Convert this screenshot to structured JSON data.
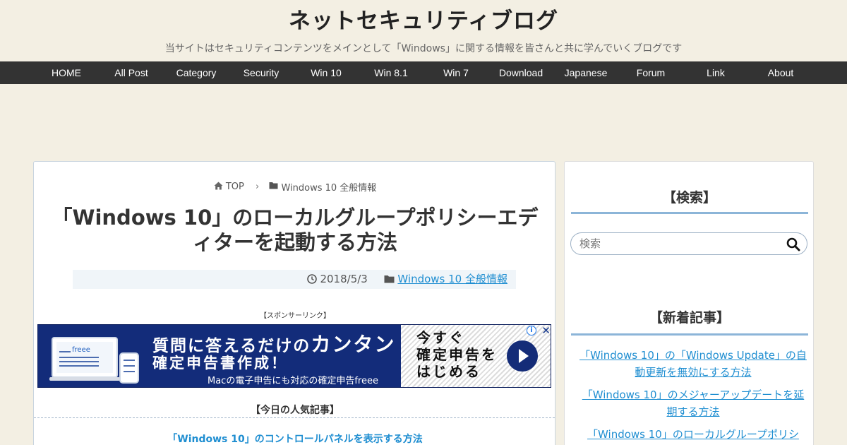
{
  "site": {
    "title": "ネットセキュリティブログ",
    "description": "当サイトはセキュリティコンテンツをメインとして「Windows」に関する情報を皆さんと共に学んでいくブログです"
  },
  "nav": {
    "items": [
      {
        "label": "HOME"
      },
      {
        "label": "All Post"
      },
      {
        "label": "Category"
      },
      {
        "label": "Security"
      },
      {
        "label": "Win 10"
      },
      {
        "label": "Win 8.1"
      },
      {
        "label": "Win 7"
      },
      {
        "label": "Download"
      },
      {
        "label": "Japanese"
      },
      {
        "label": "Forum"
      },
      {
        "label": "Link"
      },
      {
        "label": "About"
      }
    ]
  },
  "breadcrumb": {
    "home": "TOP",
    "separator": "›",
    "category": "Windows 10 全般情報"
  },
  "article": {
    "title": "「Windows 10」のローカルグループポリシーエディターを起動する方法",
    "date": "2018/5/3",
    "category": "Windows 10 全般情報",
    "sponsor_label": "【スポンサーリンク】"
  },
  "ad": {
    "line1_prefix": "質問に答えるだけの",
    "line1_highlight": "カンタン",
    "line2": "確定申告書作成！",
    "line3": "Macの電子申告にも対応の確定申告freee",
    "cta_line1": "今すぐ",
    "cta_line2": "確定申告を",
    "cta_line3": "はじめる",
    "info_glyph": "i",
    "close_glyph": "✕",
    "brand_text": "freee",
    "colors": {
      "background": "#132c7a",
      "accent": "#1a73e8"
    }
  },
  "popular": {
    "heading": "【今日の人気記事】",
    "link": "「Windows 10」のコントロールパネルを表示する方法"
  },
  "sidebar": {
    "search_title": "【検索】",
    "search_placeholder": "検索",
    "new_title": "【新着記事】",
    "new_posts": [
      {
        "title": "「Windows 10」の「Windows Update」の自動更新を無効にする方法"
      },
      {
        "title": "「Windows 10」のメジャーアップデートを延期する方法"
      },
      {
        "title": "「Windows 10」のローカルグループポリシ"
      }
    ]
  },
  "colors": {
    "page_bg": "#f3efe3",
    "nav_bg": "#333333",
    "link": "#1f8ed1",
    "widget_underline": "#8cb5d8"
  }
}
